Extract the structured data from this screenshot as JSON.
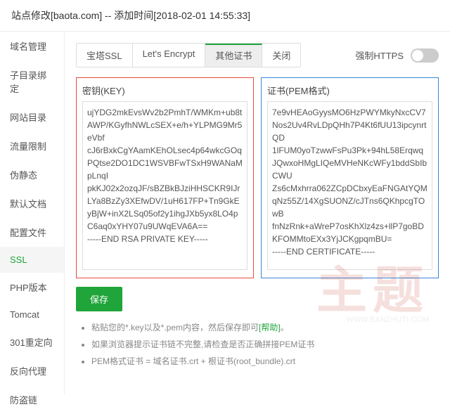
{
  "header": {
    "title": "站点修改[baota.com] -- 添加时间[2018-02-01 14:55:33]"
  },
  "sidebar": {
    "items": [
      {
        "label": "域名管理"
      },
      {
        "label": "子目录绑定"
      },
      {
        "label": "网站目录"
      },
      {
        "label": "流量限制"
      },
      {
        "label": "伪静态"
      },
      {
        "label": "默认文档"
      },
      {
        "label": "配置文件"
      },
      {
        "label": "SSL"
      },
      {
        "label": "PHP版本"
      },
      {
        "label": "Tomcat"
      },
      {
        "label": "301重定向"
      },
      {
        "label": "反向代理"
      },
      {
        "label": "防盗链"
      }
    ],
    "active": 7
  },
  "tabs": {
    "items": [
      "宝塔SSL",
      "Let's Encrypt",
      "其他证书",
      "关闭"
    ],
    "active": 2
  },
  "https": {
    "label": "强制HTTPS"
  },
  "key": {
    "label": "密钥(KEY)",
    "value": "ujYDG2mkEvsWv2b2PmhT/WMKm+ub8tAWP/KGyfhNWLcSEX+e/h+YLPMG9Mr5eVbf\ncJ6rBxkCgYAamKEhOLsec4p64wkcGOqPQtse2DO1DC1WSVBFwTSxH9WANaMpLnqI\npkKJ02x2ozqJF/sBZBkBJziHHSCKR9IJrLYa8BzZy3XEfwDV/1uH617FP+Tn9GkE\nyBjW+inX2LSq05of2y1ihgJXb5yx8LO4pC6aq0xYHY07u9UWqEVA6A==\n-----END RSA PRIVATE KEY-----"
  },
  "pem": {
    "label": "证书(PEM格式)",
    "value": "7e9vHEAoGyysMO6HzPWYMkyNxcCV7Nos2Uv4RvLDpQHh7P4Kt6fUU13ipcynrtQD\n1lFUM0yoTzwwFsPu3Pk+94hL58ErqwqJQwxoHMgLIQeMVHeNKcWFy1bddSbIbCWU\nZs6cMxhrra062ZCpDCbxyEaFNGAtYQMqNz55Z/14XgSUONZ/cJTns6QKhpcgTOwB\nfnNzRnk+aWreP7osKhXlz4zs+llP7goBDKFOMMtoEXx3YjJCKgpqmBU=\n-----END CERTIFICATE-----"
  },
  "save": {
    "label": "保存"
  },
  "tips": {
    "t1a": "粘贴您的*.key以及*.pem内容，然后保存即可",
    "t1help": "[帮助]",
    "t1b": "。",
    "t2": "如果浏览器提示证书链不完整,请检查是否正确拼接PEM证书",
    "t3": "PEM格式证书 = 域名证书.crt + 根证书(root_bundle).crt"
  },
  "watermark": {
    "main": "主题",
    "sub": "WWW.BANZHUTI.COM"
  }
}
